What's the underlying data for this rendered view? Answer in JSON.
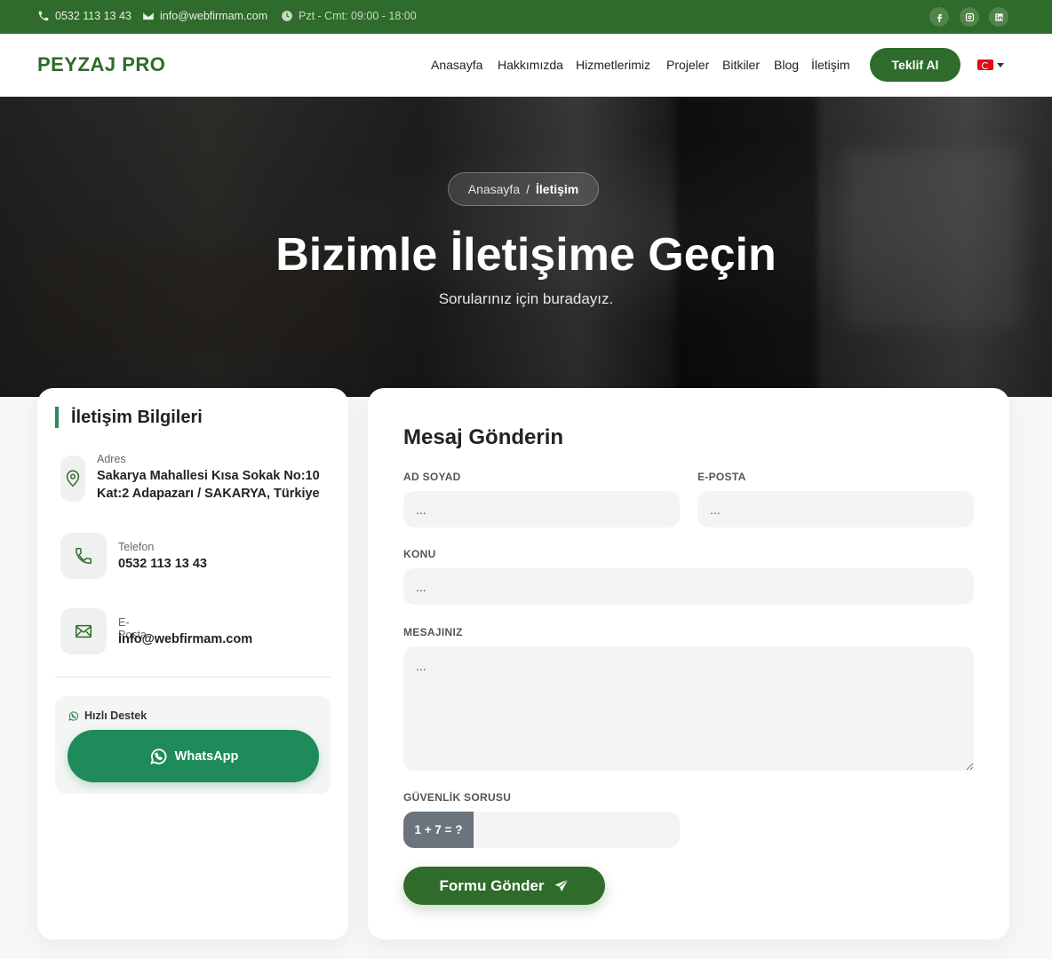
{
  "topbar": {
    "phone": "0532 113 13 43",
    "email": "info@webfirmam.com",
    "hours": "Pzt - Cmt: 09:00 - 18:00",
    "socials": [
      "facebook-icon",
      "instagram-icon",
      "linkedin-icon"
    ]
  },
  "header": {
    "logo": "PEYZAJ PRO",
    "nav": [
      "Anasayfa",
      "Hakkımızda",
      "Hizmetlerimiz",
      "Projeler",
      "Bitkiler",
      "Blog",
      "İletişim"
    ],
    "cta": "Teklif Al",
    "language_icon": "turkey-flag-icon"
  },
  "hero": {
    "breadcrumb_home": "Anasayfa",
    "breadcrumb_separator": "/",
    "breadcrumb_current": "İletişim",
    "title": "Bizimle İletişime Geçin",
    "subtitle": "Sorularınız için buradayız."
  },
  "contact_info": {
    "title": "İletişim Bilgileri",
    "address_label": "Adres",
    "address_line1": "Sakarya Mahallesi Kısa Sokak No:10",
    "address_line2": "Kat:2 Adapazarı / SAKARYA, Türkiye",
    "phone_label": "Telefon",
    "phone": "0532 113 13 43",
    "email_label": "E-Posta",
    "email": "info@webfirmam.com",
    "support_label": "Hızlı Destek",
    "whatsapp_label": "WhatsApp"
  },
  "form": {
    "title": "Mesaj Gönderin",
    "name_label": "AD SOYAD",
    "name_placeholder": "...",
    "email_label": "E-POSTA",
    "email_placeholder": "...",
    "subject_label": "KONU",
    "subject_placeholder": "...",
    "message_label": "MESAJINIZ",
    "message_placeholder": "...",
    "security_label": "GÜVENLİK SORUSU",
    "security_question": "1 + 7 = ?",
    "submit_label": "Formu Gönder"
  },
  "colors": {
    "brand_green": "#2f6b2a",
    "accent_green": "#1f8a5a",
    "topbar_bg": "#2f6b2a"
  }
}
